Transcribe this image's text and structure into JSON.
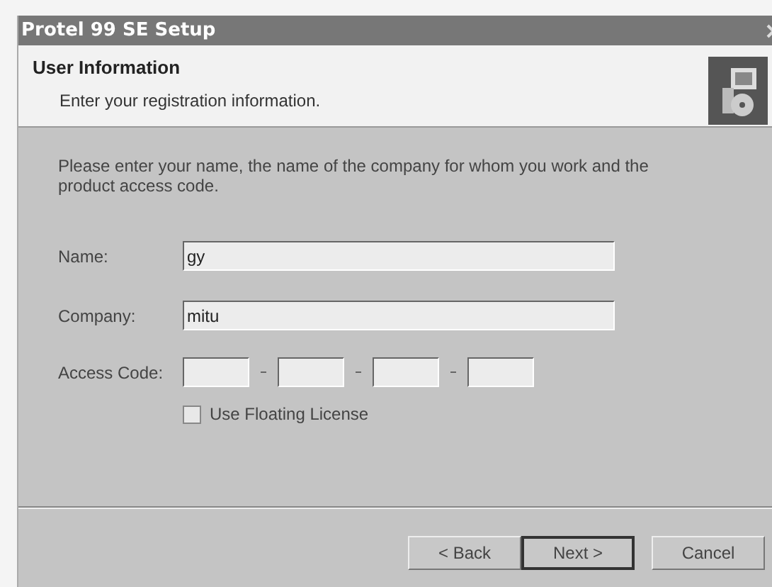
{
  "window": {
    "title": "Protel 99 SE Setup"
  },
  "header": {
    "title": "User Information",
    "subtitle": "Enter your registration information."
  },
  "instructions": "Please enter your name, the name of the company for whom you work and the product access code.",
  "fields": [
    {
      "label": "Name:",
      "value": "gy"
    },
    {
      "label": "Company:",
      "value": "mitu"
    }
  ],
  "access_code": {
    "label": "Access Code:",
    "segments": [
      {
        "kind": "box"
      },
      {
        "kind": "box"
      },
      {
        "kind": "box"
      },
      {
        "kind": "box"
      }
    ]
  },
  "floating_license": {
    "label": "Use Floating License",
    "checked": false
  },
  "buttons": [
    {
      "label": "< Back",
      "default": false
    },
    {
      "label": "Next >",
      "default": true
    },
    {
      "label": "Cancel",
      "default": false
    }
  ]
}
